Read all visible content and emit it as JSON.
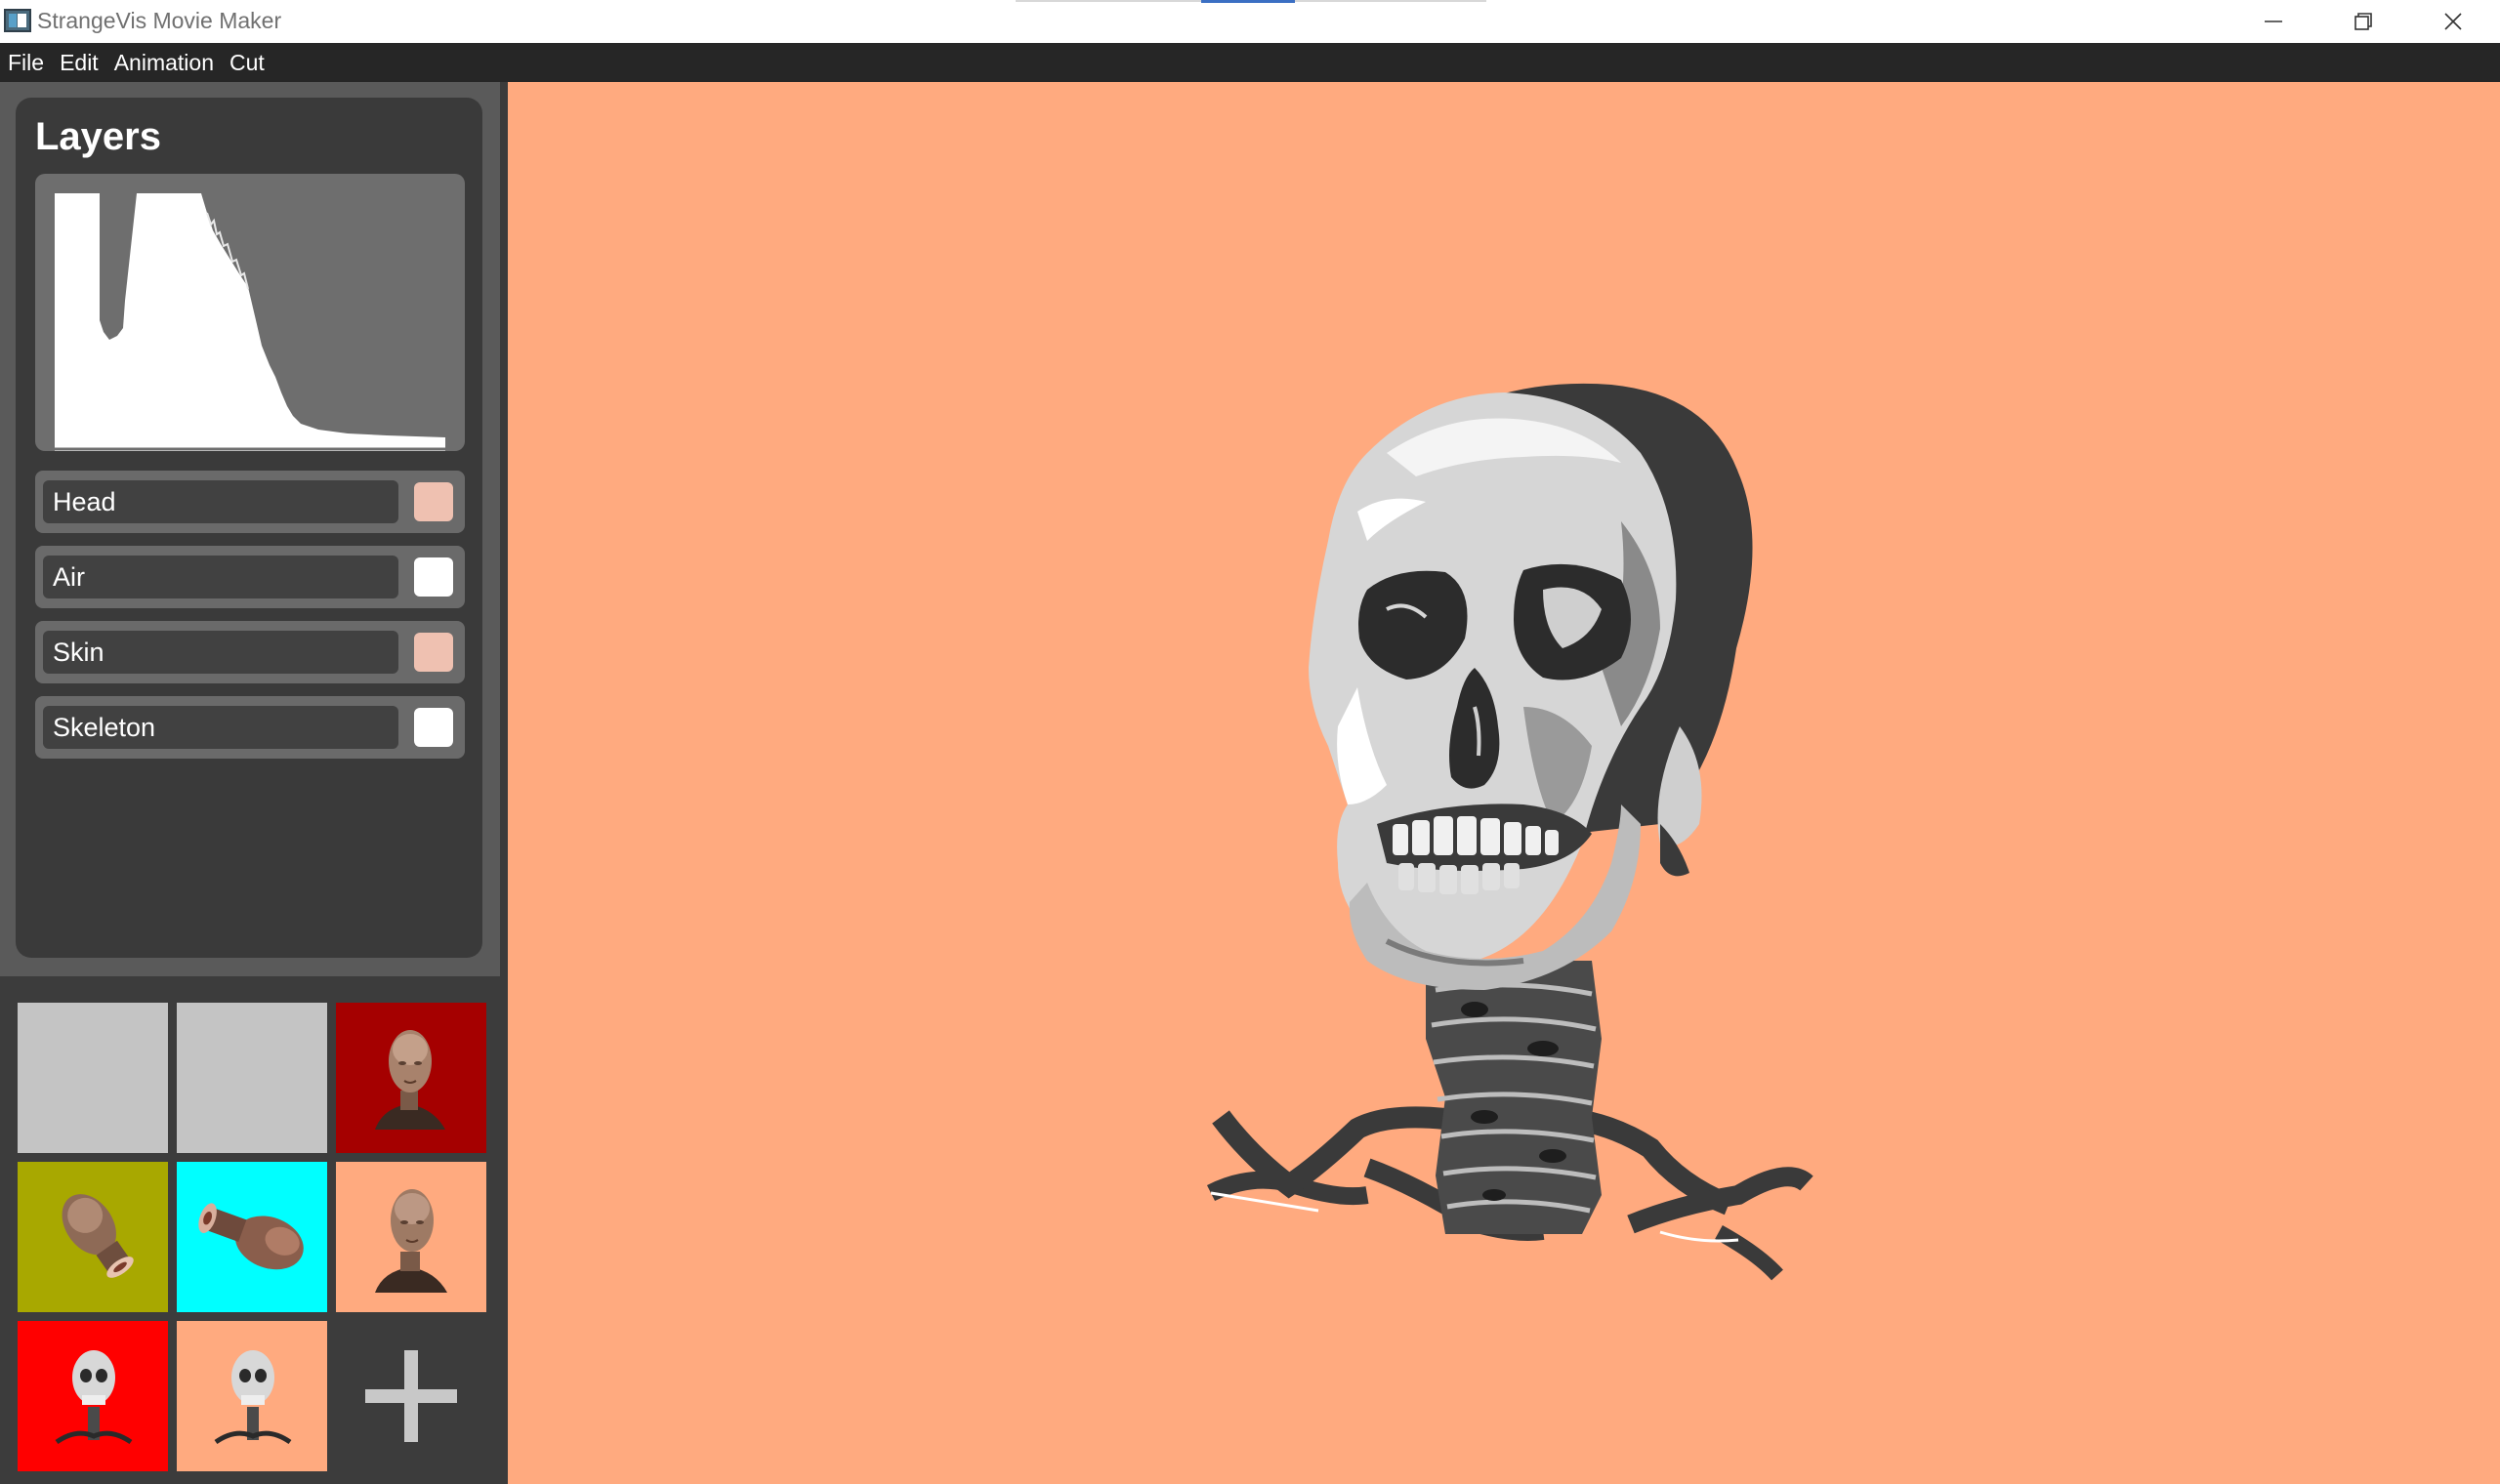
{
  "window": {
    "title": "StrangeVis Movie Maker",
    "controls": [
      "minimize-icon",
      "restore-icon",
      "close-icon"
    ]
  },
  "menu": {
    "items": [
      "File",
      "Edit",
      "Animation",
      "Cut"
    ]
  },
  "layers": {
    "title": "Layers",
    "items": [
      {
        "label": "Head",
        "color": "#efc1b1"
      },
      {
        "label": "Air",
        "color": "#ffffff"
      },
      {
        "label": "Skin",
        "color": "#efc1b1"
      },
      {
        "label": "Skeleton",
        "color": "#ffffff"
      }
    ]
  },
  "keyframes": {
    "thumbnails": [
      {
        "background": "#c4c4c4",
        "content": "empty"
      },
      {
        "background": "#c4c4c4",
        "content": "empty"
      },
      {
        "background": "#a50000",
        "content": "head-front"
      },
      {
        "background": "#a8a800",
        "content": "head-tilted"
      },
      {
        "background": "#00ffff",
        "content": "head-side"
      },
      {
        "background": "#ffaa7f",
        "content": "head-front"
      },
      {
        "background": "#ff0000",
        "content": "skeleton"
      },
      {
        "background": "#ffaa7f",
        "content": "skeleton"
      }
    ],
    "add_icon": "plus-icon"
  },
  "viewport": {
    "background": "#ffaa7f",
    "content": "skull-render"
  }
}
